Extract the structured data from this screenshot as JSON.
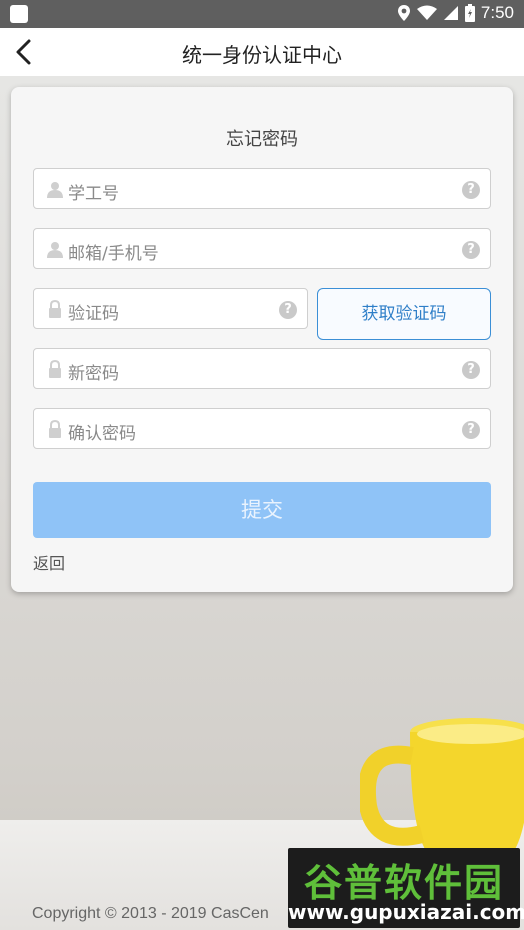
{
  "status_bar": {
    "time": "7:50"
  },
  "header": {
    "title": "统一身份认证中心",
    "back_icon": "chevron-left-icon"
  },
  "card": {
    "title": "忘记密码",
    "fields": {
      "student_id": {
        "placeholder": "学工号",
        "icon": "user-icon"
      },
      "contact": {
        "placeholder": "邮箱/手机号",
        "icon": "user-icon"
      },
      "code": {
        "placeholder": "验证码",
        "icon": "lock-icon"
      },
      "new_password": {
        "placeholder": "新密码",
        "icon": "lock-icon"
      },
      "confirm_password": {
        "placeholder": "确认密码",
        "icon": "lock-icon"
      }
    },
    "help_glyph": "?",
    "get_code_label": "获取验证码",
    "submit_label": "提交",
    "back_label": "返回"
  },
  "footer": {
    "copyright": "Copyright © 2013 - 2019 CasCen"
  },
  "watermark": {
    "brand": "谷普软件园",
    "url": "www.gupuxiazai.com"
  },
  "colors": {
    "accent": "#3b8fd6",
    "submit_bg": "#8fc3f7",
    "status_bar": "#5f5f5f"
  }
}
